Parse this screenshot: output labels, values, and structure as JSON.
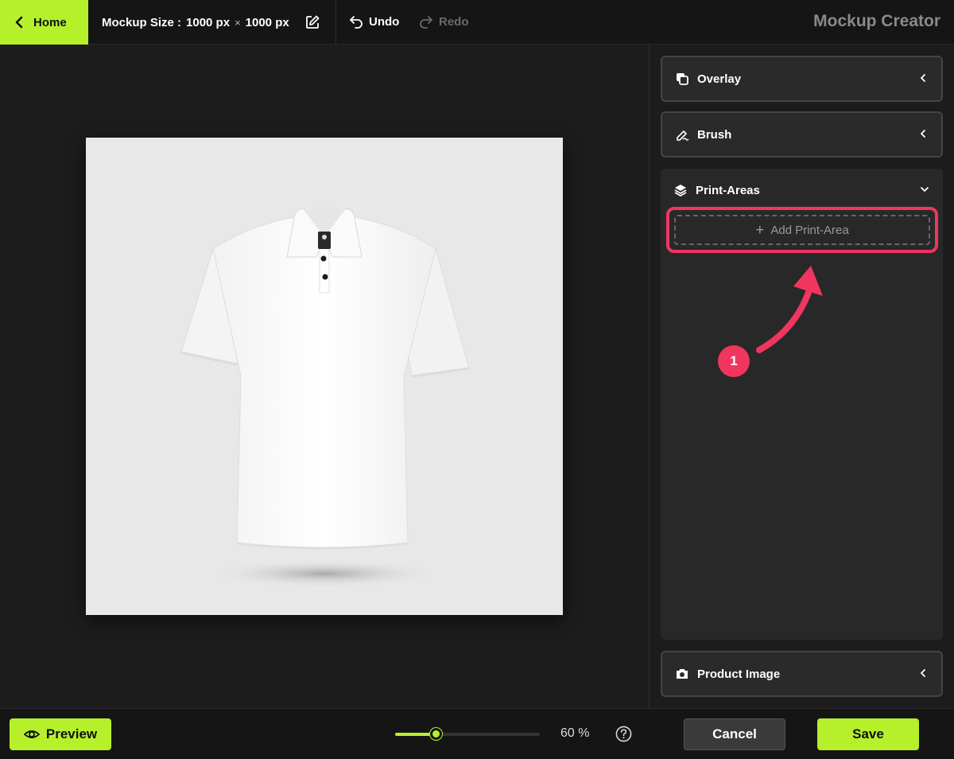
{
  "topbar": {
    "home_label": "Home",
    "size_label": "Mockup Size :",
    "width": "1000 px",
    "times": "×",
    "height": "1000 px",
    "undo_label": "Undo",
    "redo_label": "Redo",
    "app_title": "Mockup Creator"
  },
  "panel": {
    "overlay_label": "Overlay",
    "brush_label": "Brush",
    "print_areas_label": "Print-Areas",
    "add_print_area_label": "Add Print-Area",
    "product_image_label": "Product Image",
    "annotation_number": "1"
  },
  "bottombar": {
    "preview_label": "Preview",
    "zoom_label": "60 %",
    "zoom_fraction": 0.28,
    "cancel_label": "Cancel",
    "save_label": "Save"
  },
  "colors": {
    "accent": "#b5f02a",
    "highlight": "#f0365e"
  }
}
